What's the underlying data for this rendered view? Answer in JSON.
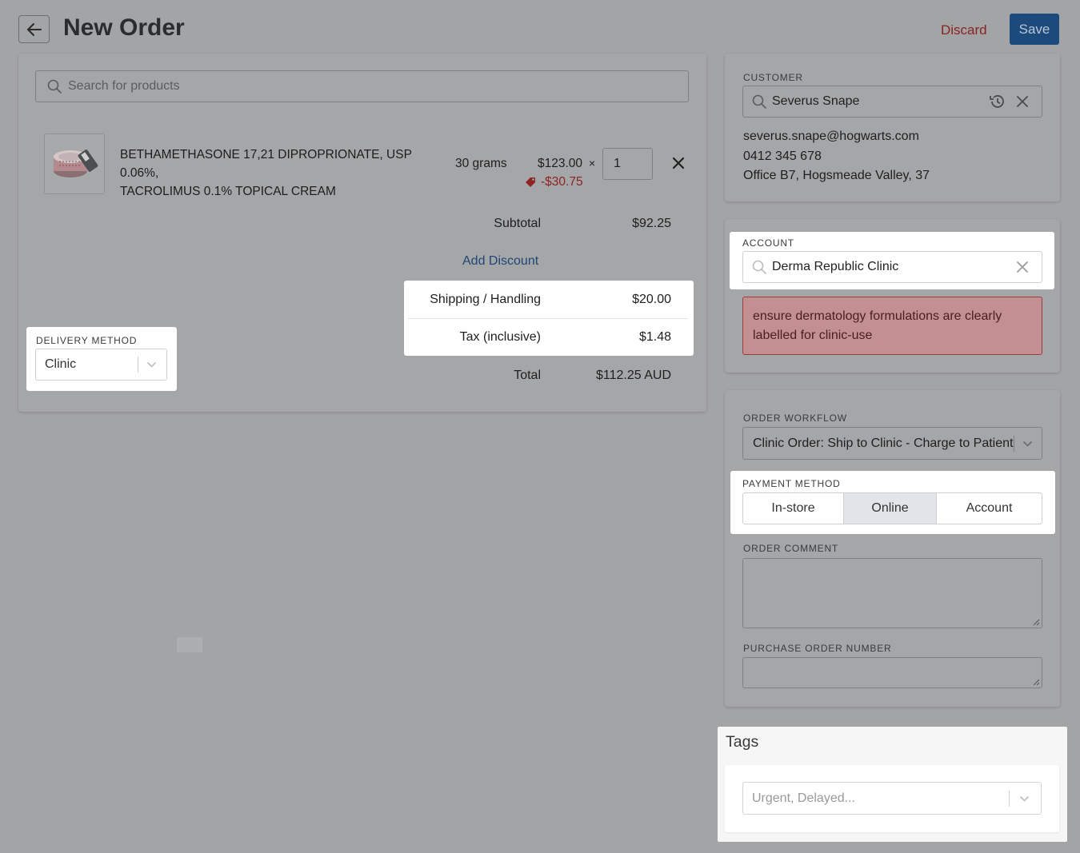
{
  "header": {
    "title": "New Order",
    "discard_label": "Discard",
    "save_label": "Save"
  },
  "products": {
    "search_placeholder": "Search for products",
    "item": {
      "name_line1": "BETHAMETHASONE 17,21 DIPROPRIONATE, USP 0.06%,",
      "name_line2": "TACROLIMUS 0.1% TOPICAL CREAM",
      "size": "30 grams",
      "price": "$123.00",
      "times": "×",
      "quantity": "1",
      "discount": "-$30.75"
    }
  },
  "summary": {
    "subtotal_label": "Subtotal",
    "subtotal_value": "$92.25",
    "add_discount_label": "Add Discount",
    "shipping_label": "Shipping / Handling",
    "shipping_value": "$20.00",
    "tax_label": "Tax (inclusive)",
    "tax_value": "$1.48",
    "total_label": "Total",
    "total_value": "$112.25 AUD"
  },
  "delivery": {
    "label": "DELIVERY METHOD",
    "value": "Clinic"
  },
  "customer": {
    "label": "CUSTOMER",
    "name": "Severus Snape",
    "email": "severus.snape@hogwarts.com",
    "phone": "0412 345 678",
    "address": "Office B7, Hogsmeade Valley, 37"
  },
  "account": {
    "label": "ACCOUNT",
    "value": "Derma Republic Clinic",
    "alert": "ensure dermatology formulations are clearly labelled for clinic-use"
  },
  "workflow": {
    "label": "ORDER WORKFLOW",
    "value": "Clinic Order: Ship to Clinic - Charge to Patient"
  },
  "payment": {
    "label": "PAYMENT METHOD",
    "options": [
      "In-store",
      "Online",
      "Account"
    ],
    "selected": "Online"
  },
  "order_comment": {
    "label": "ORDER COMMENT"
  },
  "purchase_order": {
    "label": "PURCHASE ORDER NUMBER"
  },
  "tags": {
    "title": "Tags",
    "placeholder": "Urgent, Delayed..."
  },
  "colors": {
    "accent": "#1c4a7d",
    "discard": "#8c2323",
    "link": "#1e4674",
    "alert_bg": "#c29091",
    "alert_border": "#9e3a3c"
  }
}
